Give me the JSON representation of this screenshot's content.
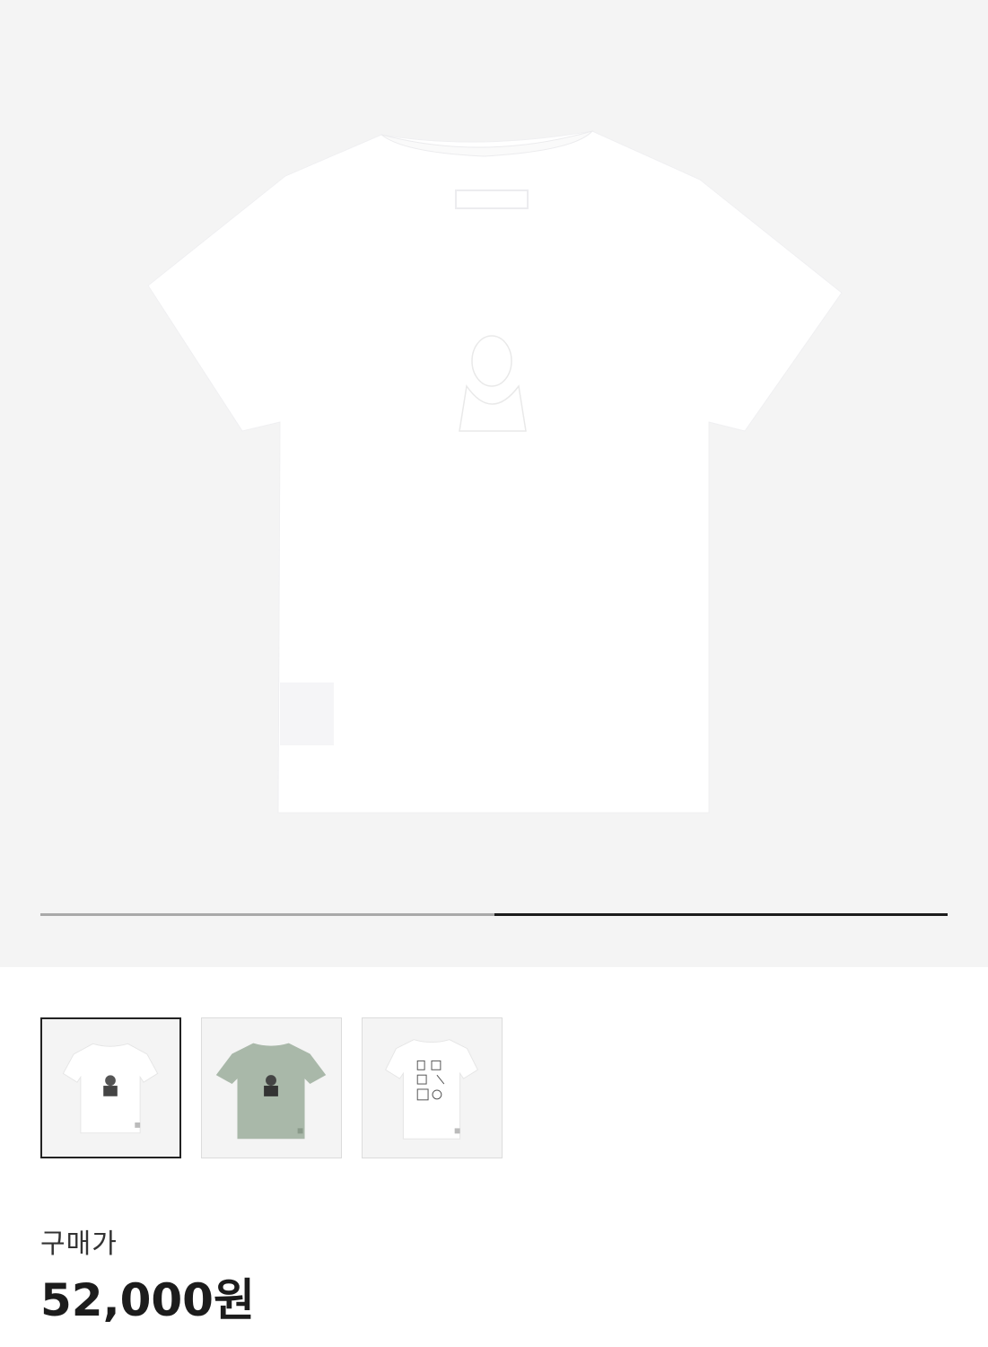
{
  "gallery": {
    "current_slide": 2,
    "total_slides": 2,
    "main_image_icon": "tshirt-back-white"
  },
  "thumbnails": [
    {
      "icon": "tshirt-white-front",
      "color": "#ffffff",
      "selected": true
    },
    {
      "icon": "tshirt-sage-front",
      "color": "#a9b8a9",
      "selected": false
    },
    {
      "icon": "tshirt-white-graphic-front",
      "color": "#ffffff",
      "selected": false
    }
  ],
  "price": {
    "label": "구매가",
    "value": "52,000원"
  },
  "colors": {
    "gallery_bg": "#f4f4f4",
    "progress_active": "#1c1c1c",
    "progress_track": "#a9a9a9",
    "selected_border": "#222222"
  }
}
